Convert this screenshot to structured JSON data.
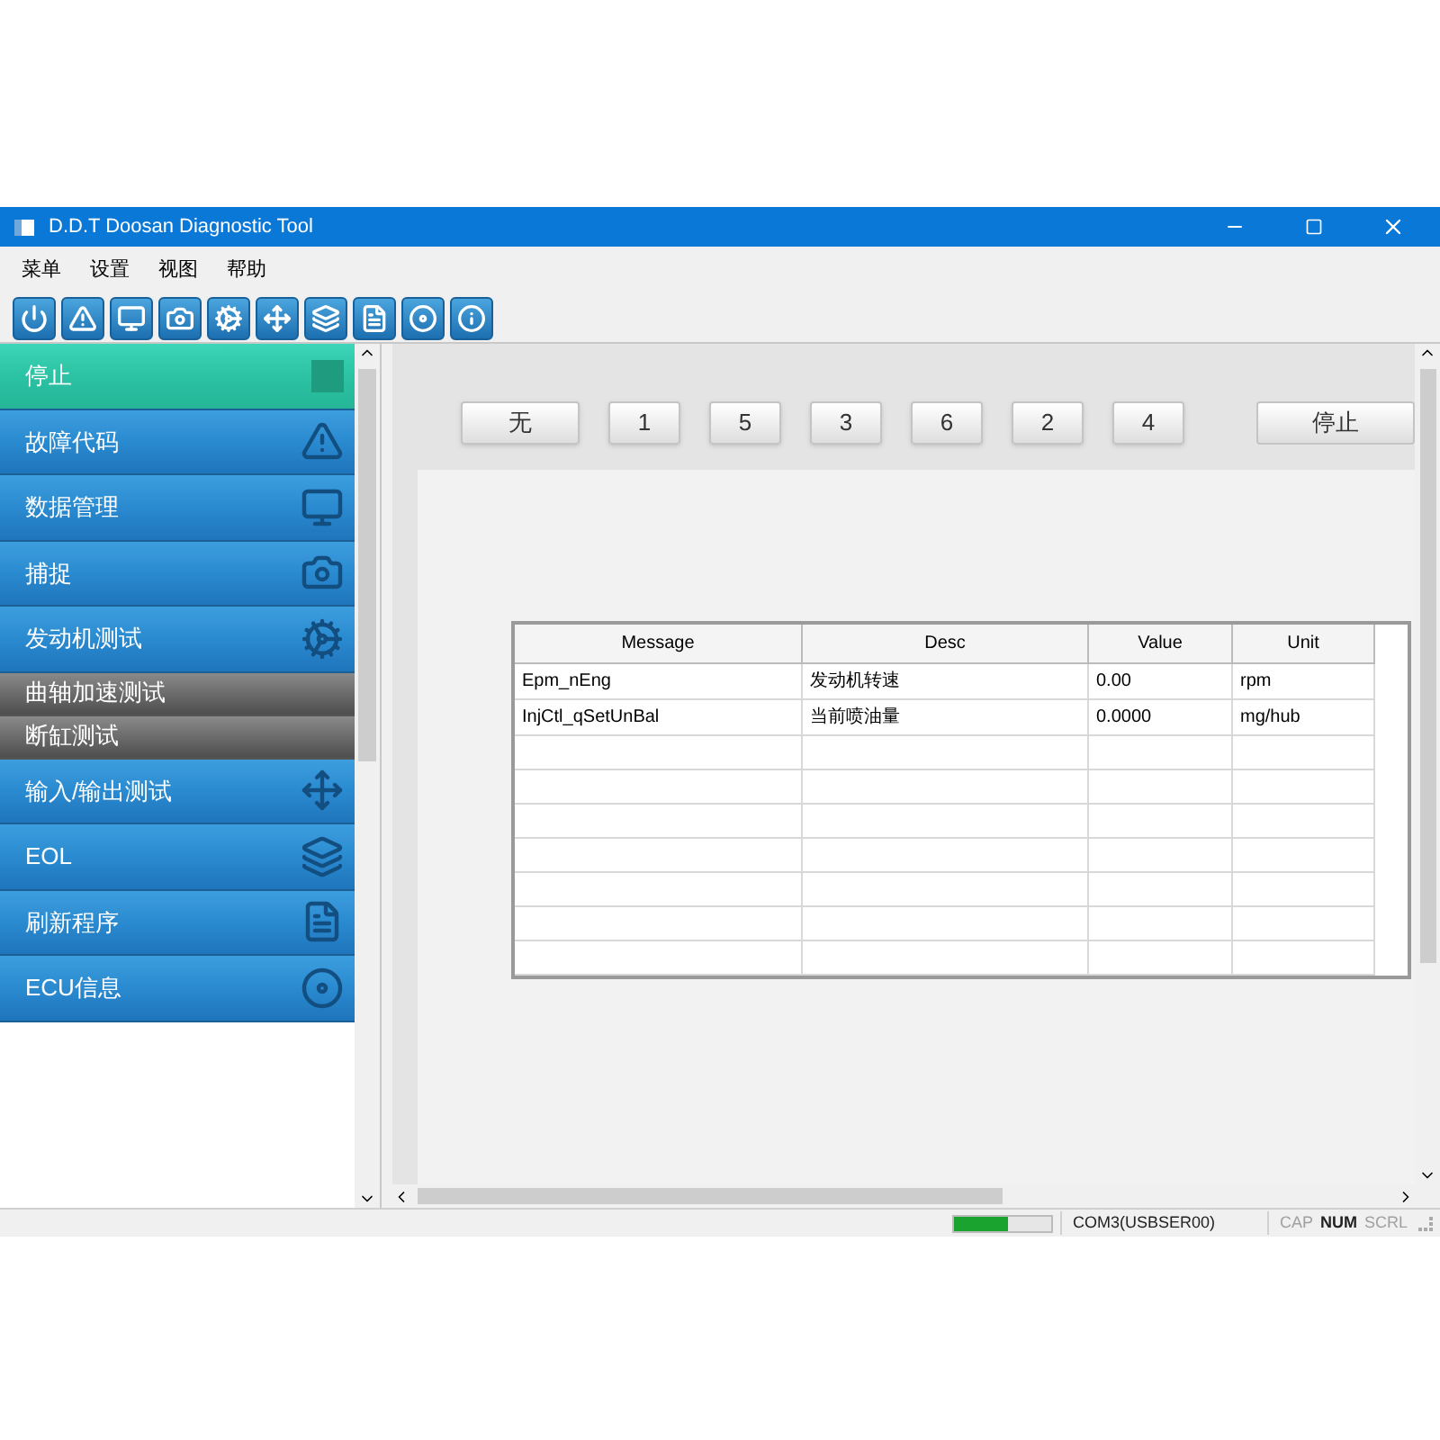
{
  "window": {
    "title": "D.D.T Doosan Diagnostic Tool"
  },
  "menu": [
    "菜单",
    "设置",
    "视图",
    "帮助"
  ],
  "sidebar": {
    "items": [
      {
        "label": "停止",
        "kind": "main",
        "selected": true
      },
      {
        "label": "故障代码",
        "kind": "main",
        "selected": false
      },
      {
        "label": "数据管理",
        "kind": "main",
        "selected": false
      },
      {
        "label": "捕捉",
        "kind": "main",
        "selected": false
      },
      {
        "label": "发动机测试",
        "kind": "main",
        "selected": false
      },
      {
        "label": "曲轴加速测试",
        "kind": "sub",
        "selected": false
      },
      {
        "label": "断缸测试",
        "kind": "sub",
        "selected": false
      },
      {
        "label": "输入/输出测试",
        "kind": "main",
        "selected": false
      },
      {
        "label": "EOL",
        "kind": "main",
        "selected": false
      },
      {
        "label": "刷新程序",
        "kind": "main",
        "selected": false
      },
      {
        "label": "ECU信息",
        "kind": "main",
        "selected": false
      }
    ]
  },
  "cylinder_buttons": [
    "无",
    "1",
    "5",
    "3",
    "6",
    "2",
    "4"
  ],
  "stop_button": "停止",
  "table": {
    "columns": [
      "Message",
      "Desc",
      "Value",
      "Unit"
    ],
    "rows": [
      [
        "Epm_nEng",
        "发动机转速",
        "0.00",
        "rpm"
      ],
      [
        "InjCtl_qSetUnBal",
        "当前喷油量",
        "0.0000",
        "mg/hub"
      ]
    ]
  },
  "status_bar": {
    "progress": {
      "level": 0.55
    },
    "port": "COM3(USBSER00)",
    "indicators": [
      {
        "label": "CAP",
        "on": false
      },
      {
        "label": "NUM",
        "on": true
      },
      {
        "label": "SCRL",
        "on": false
      }
    ]
  }
}
